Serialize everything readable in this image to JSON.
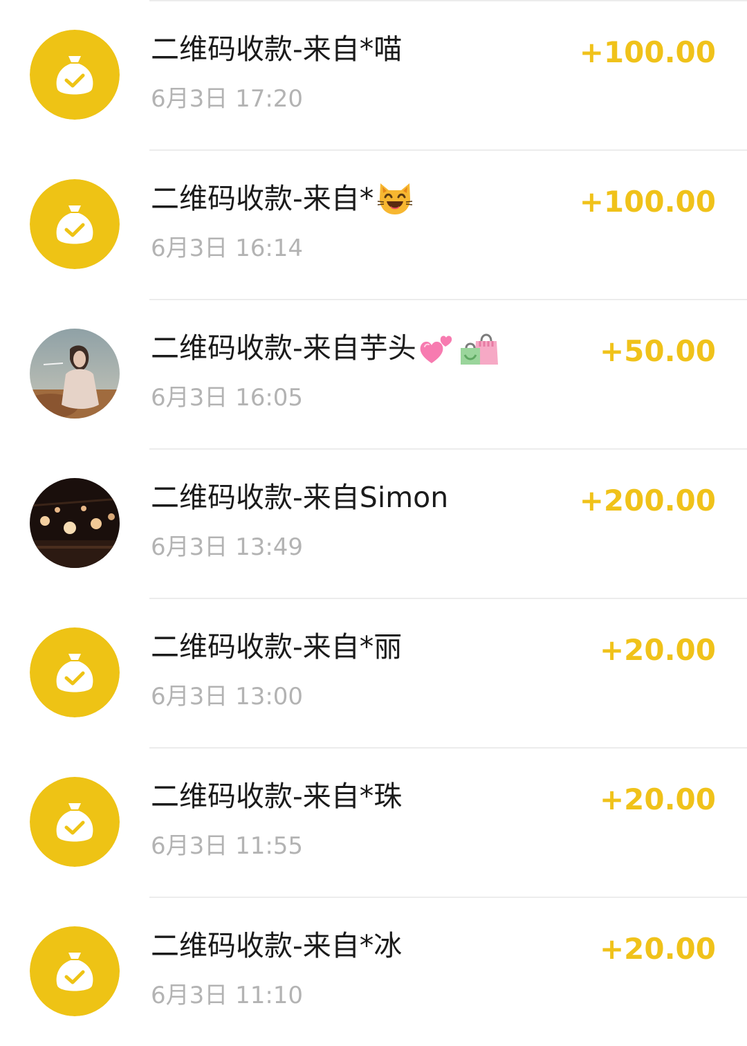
{
  "colors": {
    "amount": "#f0c21a",
    "avatar_yellow": "#eec315",
    "title_text": "#1b1b1b",
    "time_text": "#b3b3b3",
    "divider": "#ececec"
  },
  "transactions": [
    {
      "title": "二维码收款-来自*喵",
      "time": "6月3日 17:20",
      "amount": "+100.00",
      "avatar": "money-bag-icon",
      "emoji": []
    },
    {
      "title": "二维码收款-来自*",
      "time": "6月3日 16:14",
      "amount": "+100.00",
      "avatar": "money-bag-icon",
      "emoji": [
        "smiling-cat-emoji"
      ]
    },
    {
      "title": "二维码收款-来自芋头",
      "time": "6月3日 16:05",
      "amount": "+50.00",
      "avatar": "user-photo-avatar",
      "emoji": [
        "two-hearts-emoji",
        "shopping-bags-emoji"
      ]
    },
    {
      "title": "二维码收款-来自Simon",
      "time": "6月3日 13:49",
      "amount": "+200.00",
      "avatar": "user-photo-avatar",
      "emoji": []
    },
    {
      "title": "二维码收款-来自*丽",
      "time": "6月3日 13:00",
      "amount": "+20.00",
      "avatar": "money-bag-icon",
      "emoji": []
    },
    {
      "title": "二维码收款-来自*珠",
      "time": "6月3日 11:55",
      "amount": "+20.00",
      "avatar": "money-bag-icon",
      "emoji": []
    },
    {
      "title": "二维码收款-来自*冰",
      "time": "6月3日 11:10",
      "amount": "+20.00",
      "avatar": "money-bag-icon",
      "emoji": []
    }
  ]
}
